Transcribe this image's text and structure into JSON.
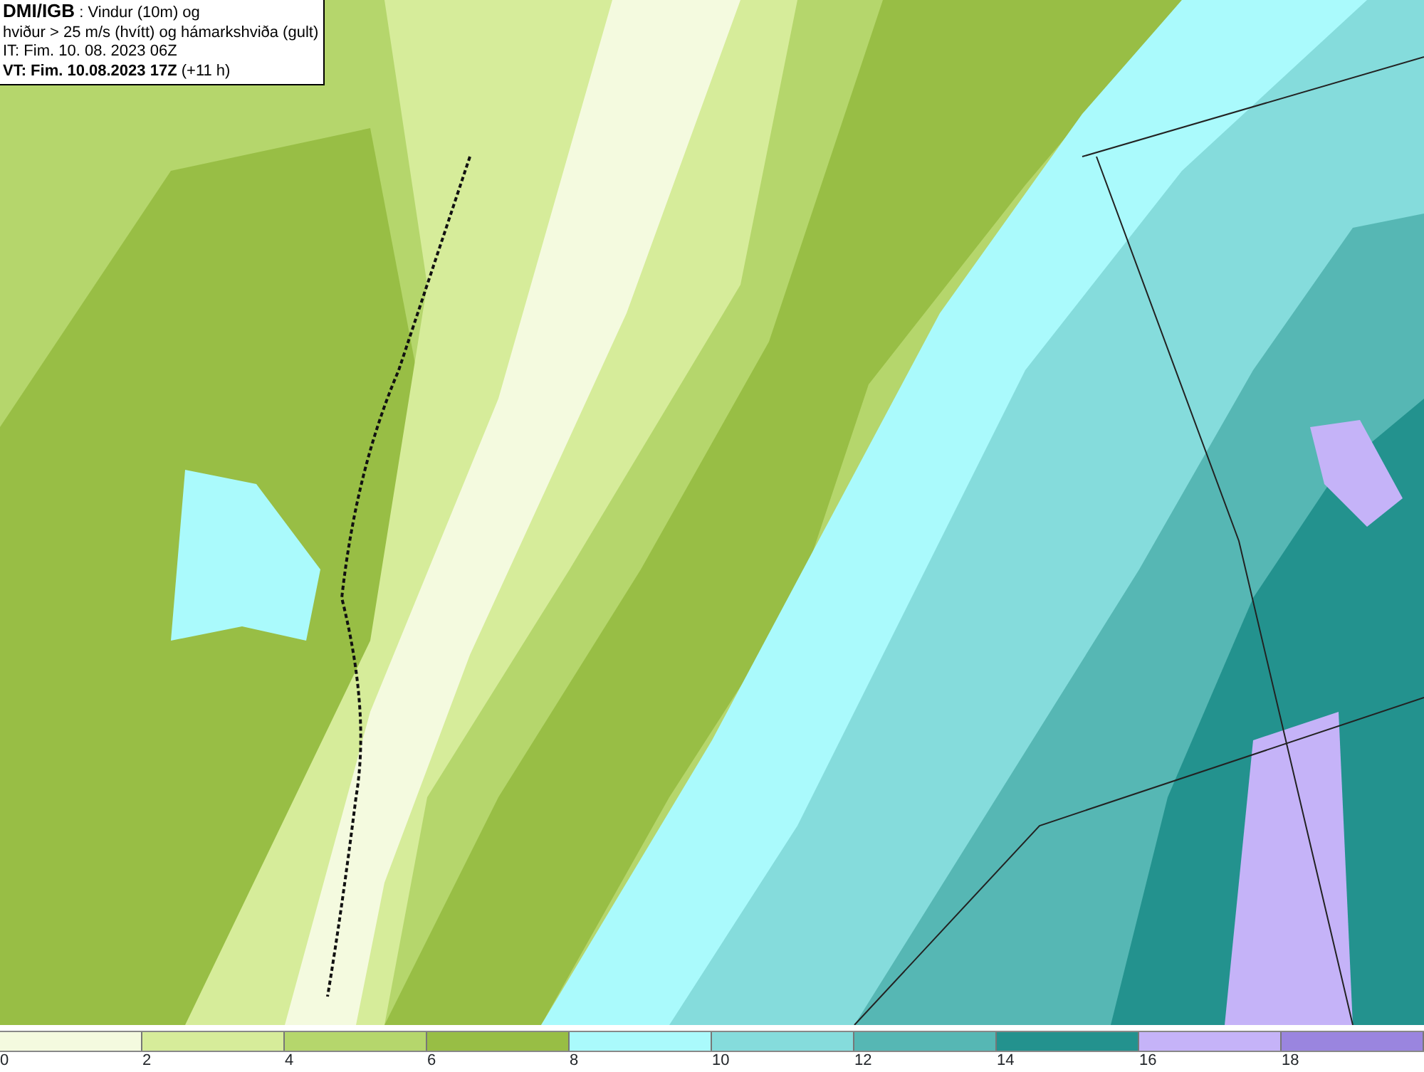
{
  "header": {
    "source": "DMI/IGB",
    "title": ": Vindur (10m) og",
    "subtitle": "hviður > 25 m/s (hvítt) og hámarkshviða (gult)",
    "issue_time": "IT: Fim. 10. 08. 2023 06Z",
    "valid_time": "VT: Fim. 10.08.2023 17Z",
    "lead": "(+11 h)"
  },
  "legend": [
    {
      "label": "0",
      "color": "#f4fadf"
    },
    {
      "label": "2",
      "color": "#d6ec9a"
    },
    {
      "label": "4",
      "color": "#b5d66c"
    },
    {
      "label": "6",
      "color": "#98be45"
    },
    {
      "label": "8",
      "color": "#aafafc"
    },
    {
      "label": "10",
      "color": "#85dcdc"
    },
    {
      "label": "12",
      "color": "#56b7b4"
    },
    {
      "label": "14",
      "color": "#23928e"
    },
    {
      "label": "16",
      "color": "#c5b3f8"
    },
    {
      "label": "18",
      "color": "#9a85df"
    }
  ]
}
